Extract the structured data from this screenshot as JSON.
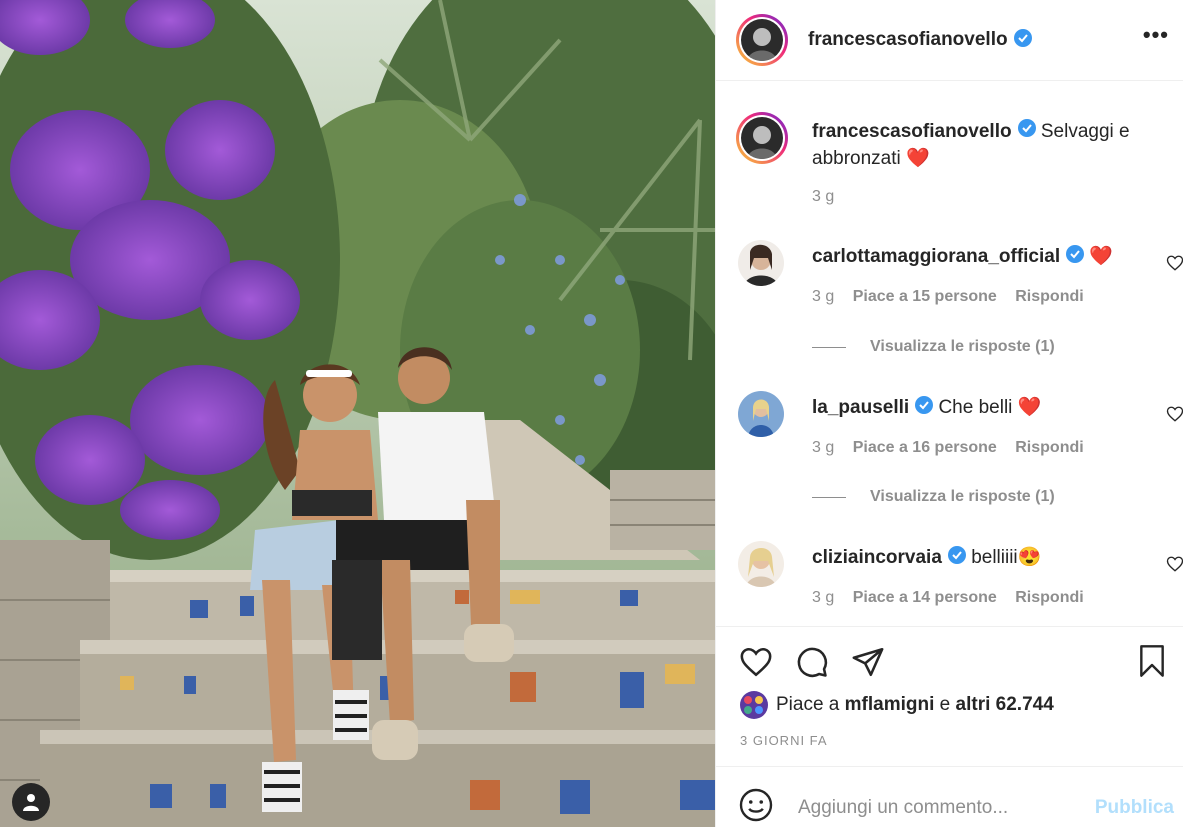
{
  "header": {
    "username": "francescasofianovello",
    "more_label": "•••"
  },
  "caption": {
    "username": "francescasofianovello",
    "text": "Selvaggi e abbronzati",
    "emoji": "❤️",
    "time": "3 g"
  },
  "comments": [
    {
      "username": "carlottamaggiorana_official",
      "text": "",
      "emoji": "❤️",
      "time": "3 g",
      "likes": "Piace a 15 persone",
      "reply": "Rispondi",
      "view_replies": "Visualizza le risposte (1)"
    },
    {
      "username": "la_pauselli",
      "text": "Che belli",
      "emoji": "❤️",
      "time": "3 g",
      "likes": "Piace a 16 persone",
      "reply": "Rispondi",
      "view_replies": "Visualizza le risposte (1)"
    },
    {
      "username": "cliziaincorvaia",
      "text": "belliiii",
      "emoji": "😍",
      "time": "3 g",
      "likes": "Piace a 14 persone",
      "reply": "Rispondi"
    }
  ],
  "likes_summary": {
    "prefix": "Piace a",
    "user": "mflamigni",
    "connector": "e",
    "others": "altri 62.744"
  },
  "date": "3 GIORNI FA",
  "add_comment": {
    "placeholder": "Aggiungi un commento...",
    "publish_label": "Pubblica"
  },
  "icons": {
    "verified": "verified-badge-icon",
    "like": "heart-icon",
    "comment": "comment-icon",
    "share": "paper-plane-icon",
    "save": "bookmark-icon",
    "emoji": "smiley-icon",
    "user_tags": "user-icon"
  },
  "colors": {
    "verified_blue": "#3897f0",
    "red_heart": "#ed4956",
    "muted_text": "#8e8e8e",
    "publish_disabled": "#b2dffc"
  }
}
